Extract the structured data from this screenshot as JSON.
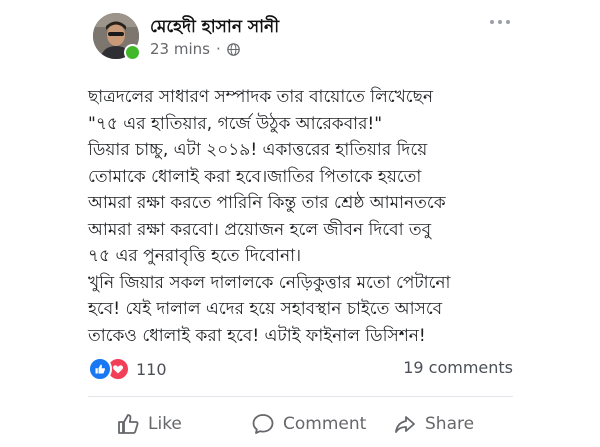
{
  "post": {
    "author": "মেহেদী হাসান সানী",
    "time": "23 mins",
    "separator": "·",
    "text_lines": [
      "ছাত্রদলের সাধারণ সম্পাদক তার বায়োতে লিখেছেন",
      "\"৭৫ এর হাতিয়ার, গর্জে উঠুক আরেকবার!\"",
      "ডিয়ার চাচ্চু, এটা ২০১৯! একাত্তরের হাতিয়ার দিয়ে",
      "তোমাকে ধোলাই করা হবে।জাতির পিতাকে হয়তো",
      "আমরা রক্ষা করতে পারিনি কিন্তু তার শ্রেষ্ঠ আমানতকে",
      "আমরা রক্ষা করবো। প্রয়োজন হলে জীবন দিবো তবু",
      "৭৫ এর পুনরাবৃত্তি হতে দিবোনা।",
      "খুনি জিয়ার সকল দালালকে নেড়িকুত্তার মতো পেটানো",
      "হবে! যেই দালাল এদের হয়ে সহাবস্থান চাইতে আসবে",
      "তাকেও ধোলাই করা হবে! এটাই ফাইনাল ডিসিশন!"
    ]
  },
  "stats": {
    "reaction_count": "110",
    "comments_label": "19 comments"
  },
  "actions": {
    "like": "Like",
    "comment": "Comment",
    "share": "Share"
  },
  "icons": {
    "like_reaction": "thumbs-up-icon",
    "love_reaction": "heart-icon",
    "more": "more-options-icon",
    "privacy": "globe-icon"
  },
  "colors": {
    "like_blue": "#1877f2",
    "love_red": "#f33e58",
    "online_green": "#42b72a",
    "muted": "#65676b"
  }
}
